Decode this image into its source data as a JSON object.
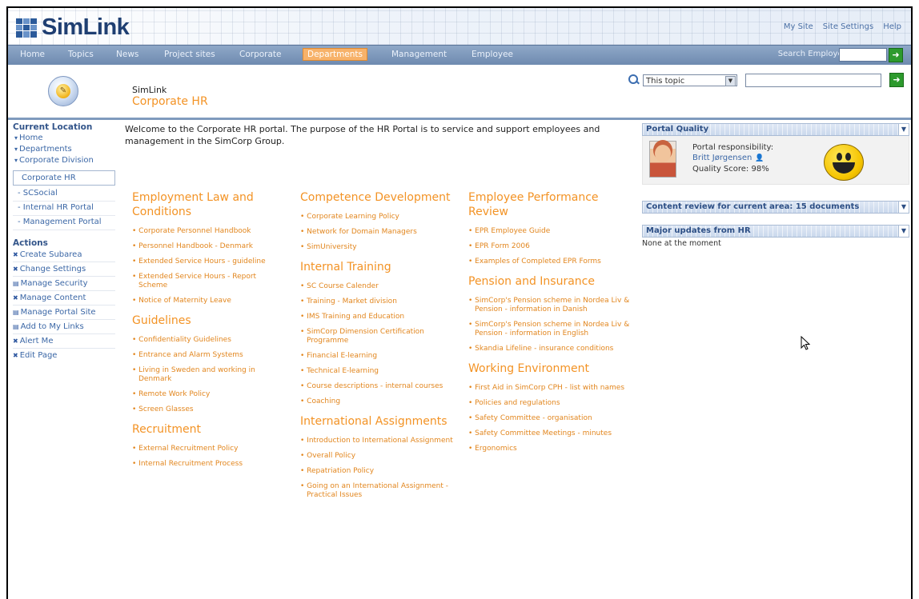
{
  "header": {
    "logo_text": "SimLink",
    "top_links": [
      "My Site",
      "Site Settings",
      "Help"
    ]
  },
  "nav": {
    "items": [
      "Home",
      "Topics",
      "News",
      "Project sites",
      "Corporate",
      "Departments",
      "Management",
      "Employee"
    ],
    "active": "Departments",
    "search_label": "Search Employees"
  },
  "subheader": {
    "site_name": "SimLink",
    "page_title": "Corporate HR",
    "scope_value": "This topic"
  },
  "leftnav": {
    "current_location_title": "Current Location",
    "breadcrumbs": [
      "Home",
      "Departments",
      "Corporate Division"
    ],
    "current": "Corporate HR",
    "subitems": [
      "SCSocial",
      "Internal HR Portal",
      "Management Portal"
    ],
    "actions_title": "Actions",
    "actions": [
      "Create Subarea",
      "Change Settings",
      "Manage Security",
      "Manage Content",
      "Manage Portal Site",
      "Add to My Links",
      "Alert Me",
      "Edit Page"
    ]
  },
  "main": {
    "welcome": "Welcome to the Corporate HR portal. The purpose of the HR Portal is to service and support employees and management in the SimCorp Group.",
    "col1": [
      {
        "title": "Employment Law and Conditions",
        "links": [
          "Corporate Personnel Handbook",
          "Personnel Handbook - Denmark",
          "Extended Service Hours - guideline",
          "Extended Service Hours - Report Scheme",
          "Notice of Maternity Leave"
        ]
      },
      {
        "title": "Guidelines",
        "links": [
          "Confidentiality Guidelines",
          "Entrance and Alarm Systems",
          "Living in Sweden and working in Denmark",
          "Remote Work Policy",
          "Screen Glasses"
        ]
      },
      {
        "title": "Recruitment",
        "links": [
          "External Recruitment Policy",
          "Internal Recruitment Process"
        ]
      }
    ],
    "col2": [
      {
        "title": "Competence Development",
        "links": [
          "Corporate Learning Policy",
          "Network for Domain Managers",
          "SimUniversity"
        ]
      },
      {
        "title": "Internal Training",
        "links": [
          "SC Course Calender",
          "Training - Market division",
          "IMS Training and Education",
          "SimCorp Dimension Certification Programme",
          "Financial E-learning",
          "Technical E-learning",
          "Course descriptions - internal courses",
          "Coaching"
        ]
      },
      {
        "title": "International Assignments",
        "links": [
          "Introduction to International Assignment",
          "Overall Policy",
          "Repatriation Policy",
          "Going on an International Assignment - Practical Issues"
        ]
      }
    ],
    "col3": [
      {
        "title": "Employee Performance Review",
        "links": [
          "EPR Employee Guide",
          "EPR Form 2006",
          "Examples of Completed EPR Forms"
        ]
      },
      {
        "title": "Pension and Insurance",
        "links": [
          "SimCorp's Pension scheme in Nordea Liv & Pension - information in Danish",
          "SimCorp's Pension scheme in Nordea Liv & Pension - information in English",
          "Skandia Lifeline - insurance conditions"
        ]
      },
      {
        "title": "Working Environment",
        "links": [
          "First Aid in SimCorp CPH - list with names",
          "Policies and regulations",
          "Safety Committee - organisation",
          "Safety Committee Meetings - minutes",
          "Ergonomics"
        ]
      }
    ]
  },
  "right": {
    "quality": {
      "title": "Portal Quality",
      "responsibility_label": "Portal responsibility:",
      "responsible_name": "Britt Jørgensen",
      "score_text": "Quality Score: 98%"
    },
    "content_review": "Content review for current area: 15 documents",
    "updates_title": "Major updates from HR",
    "updates_text": "None at the moment"
  }
}
